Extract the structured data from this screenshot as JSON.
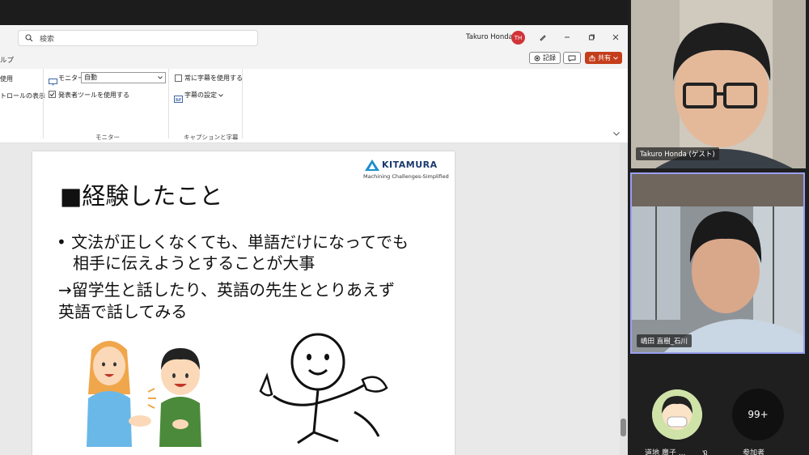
{
  "window": {
    "search_placeholder": "検索",
    "user_name": "Takuro Honda",
    "user_initials": "TH"
  },
  "command_bar": {
    "help_fragment": "ルプ",
    "record_label": "記録",
    "share_label": "共有"
  },
  "ribbon": {
    "left_item_1": "使用",
    "left_item_2": "トロールの表示",
    "monitor_label": "モニター:",
    "monitor_value": "自動",
    "presenter_tools_label": "発表者ツールを使用する",
    "monitor_group": "モニター",
    "always_subtitles_label": "常に字幕を使用する",
    "subtitle_settings_label": "字幕の設定",
    "captions_group": "キャプションと字幕"
  },
  "slide": {
    "title": "■経験したこと",
    "bullet_line_1": "•  文法が正しくなくても、単語だけになってでも",
    "bullet_line_2": "相手に伝えようとすることが大事",
    "arrow_line_1": "→留学生と話したり、英語の先生ととりあえず",
    "arrow_line_2": "英語で話してみる",
    "logo_name": "KITAMURA",
    "logo_tagline": "Machining Challenges-Simplified"
  },
  "participants": {
    "tile1_name": "Takuro Honda (ゲスト)",
    "tile2_name": "嶋田 直樹_石川",
    "bottom_name": "道地 廣子 ...",
    "more_count": "99+",
    "more_label": "参加者"
  },
  "colors": {
    "share_red": "#c43e1c",
    "avatar_red": "#d13438",
    "active_speaker_border": "#9aa0f0"
  }
}
